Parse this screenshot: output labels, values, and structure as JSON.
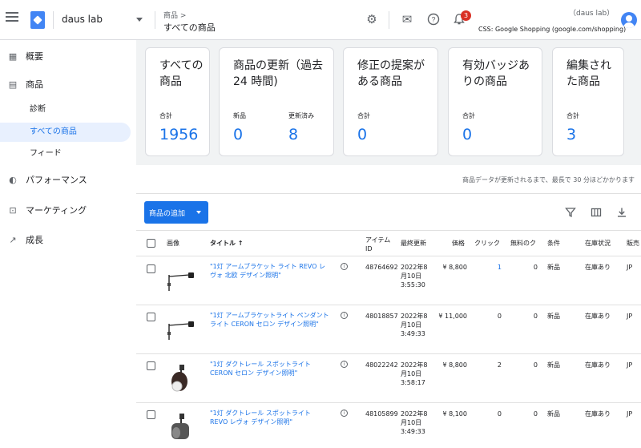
{
  "topbar": {
    "account": "daus lab",
    "breadcrumb": "商品 >",
    "page_title": "すべての商品",
    "notifications_count": "3",
    "user_name": "（daus lab）",
    "store_name": "CSS: Google Shopping (google.com/shopping)"
  },
  "sidebar": {
    "items": [
      {
        "label": "概要",
        "icon": "overview-icon"
      },
      {
        "label": "商品",
        "icon": "products-icon"
      },
      {
        "label": "パフォーマンス",
        "icon": "performance-icon"
      },
      {
        "label": "マーケティング",
        "icon": "marketing-icon"
      },
      {
        "label": "成長",
        "icon": "growth-icon"
      }
    ],
    "sub_items": [
      {
        "label": "診断"
      },
      {
        "label": "すべての商品"
      },
      {
        "label": "フィード"
      }
    ]
  },
  "cards": [
    {
      "title": "すべての商品",
      "labels": [
        "合計"
      ],
      "values": [
        "1956"
      ]
    },
    {
      "title": "商品の更新（過去 24 時間)",
      "labels": [
        "新品",
        "更新済み"
      ],
      "values": [
        "0",
        "8"
      ]
    },
    {
      "title": "修正の提案がある商品",
      "labels": [
        "合計"
      ],
      "values": [
        "0"
      ]
    },
    {
      "title": "有効バッジありの商品",
      "labels": [
        "合計"
      ],
      "values": [
        "0"
      ]
    },
    {
      "title": "編集された商品",
      "labels": [
        "合計"
      ],
      "values": [
        "3"
      ]
    }
  ],
  "notice": "商品データが更新されるまで、最長で 30 分ほどかかります",
  "add_button_label": "商品の追加",
  "table": {
    "headers": [
      "画像",
      "タイトル ↑",
      "アイテム ID",
      "最終更新",
      "価格",
      "クリック",
      "無料のク",
      "条件",
      "在庫状況",
      "販売"
    ],
    "rows": [
      {
        "title": "\"1灯 アームブラケット ライト REVO レヴォ 北欧 デザイン照明\"",
        "id": "48764692",
        "updated": "2022年8月10日 3:55:30",
        "price": "¥ 8,800",
        "clicks": "1",
        "free": "0",
        "condition": "新品",
        "availability": "在庫あり",
        "country": "JP"
      },
      {
        "title": "\"1灯 アームブラケットライト ペンダントライト CERON セロン デザイン照明\"",
        "id": "48018857",
        "updated": "2022年8月10日 3:49:33",
        "price": "¥ 11,000",
        "clicks": "0",
        "free": "0",
        "condition": "新品",
        "availability": "在庫あり",
        "country": "JP"
      },
      {
        "title": "\"1灯 ダクトレール スポットライト CERON セロン デザイン照明\"",
        "id": "48022242",
        "updated": "2022年8月10日 3:58:17",
        "price": "¥ 8,800",
        "clicks": "2",
        "free": "0",
        "condition": "新品",
        "availability": "在庫あり",
        "country": "JP"
      },
      {
        "title": "\"1灯 ダクトレール スポットライト REVO レヴォ デザイン照明\"",
        "id": "48105899",
        "updated": "2022年8月10日 3:49:33",
        "price": "¥ 8,100",
        "clicks": "0",
        "free": "0",
        "condition": "新品",
        "availability": "在庫あり",
        "country": "JP"
      }
    ]
  }
}
